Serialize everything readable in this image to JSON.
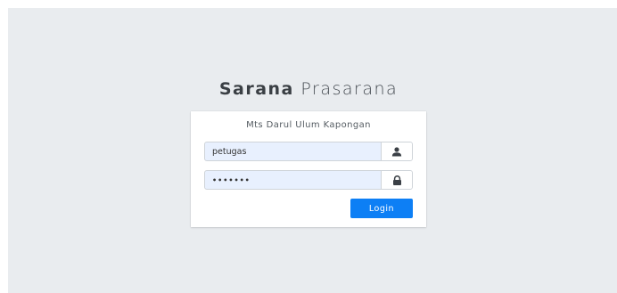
{
  "brand": {
    "bold": "Sarana",
    "light": "Prasarana"
  },
  "login_box": {
    "subtitle": "Mts Darul Ulum Kapongan",
    "username": {
      "value": "petugas",
      "icon": "user-icon"
    },
    "password": {
      "value": "•••••••",
      "icon": "lock-icon"
    },
    "login_label": "Login"
  },
  "colors": {
    "background": "#e9ecef",
    "input_autofill": "#e8f0fe",
    "button": "#0d7ff5"
  }
}
